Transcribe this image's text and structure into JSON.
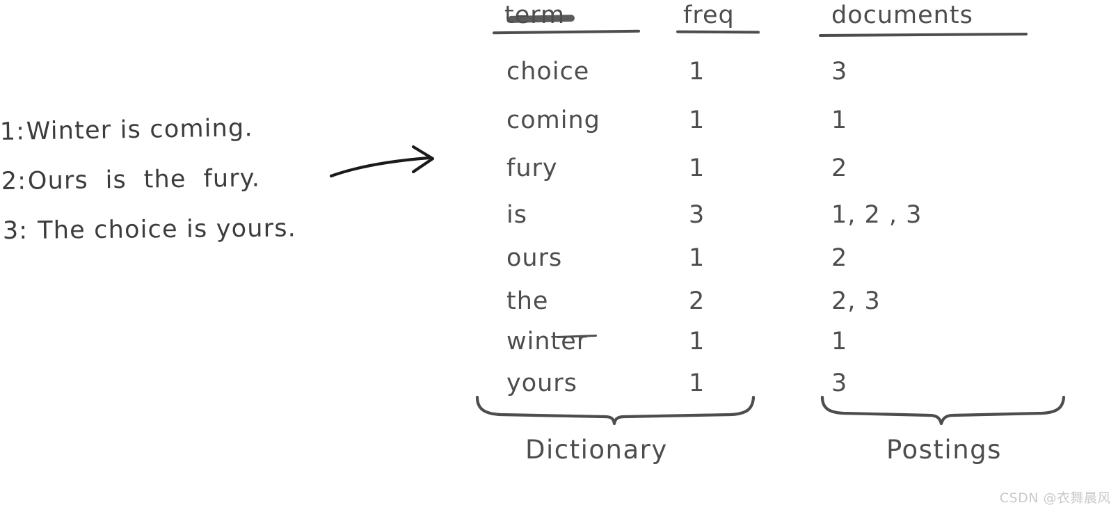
{
  "documents": {
    "lines": [
      {
        "num": "1:",
        "text": "Winter is coming."
      },
      {
        "num": "2:",
        "text": "Ours  is  the  fury."
      },
      {
        "num": "3:",
        "text": " The choice is yours."
      }
    ]
  },
  "arrow": {
    "icon": "right-arrow-icon"
  },
  "table": {
    "headers": {
      "term": "term",
      "freq": "freq",
      "documents": "documents"
    },
    "rows": [
      {
        "term": "choice",
        "freq": "1",
        "documents": "3"
      },
      {
        "term": "coming",
        "freq": "1",
        "documents": "1"
      },
      {
        "term": "fury",
        "freq": "1",
        "documents": "2"
      },
      {
        "term": "is",
        "freq": "3",
        "documents": "1, 2 , 3"
      },
      {
        "term": "ours",
        "freq": "1",
        "documents": "2"
      },
      {
        "term": "the",
        "freq": "2",
        "documents": "2, 3"
      },
      {
        "term": "winter",
        "freq": "1",
        "documents": "1"
      },
      {
        "term": "yours",
        "freq": "1",
        "documents": "3"
      }
    ]
  },
  "captions": {
    "dictionary": "Dictionary",
    "postings": "Postings"
  },
  "watermark": {
    "text": "CSDN @衣舞晨风"
  },
  "colors": {
    "ink_dark": "#3c3c3c",
    "ink": "#4d4d4d",
    "background": "#ffffff",
    "watermark": "#c9c9c9"
  }
}
